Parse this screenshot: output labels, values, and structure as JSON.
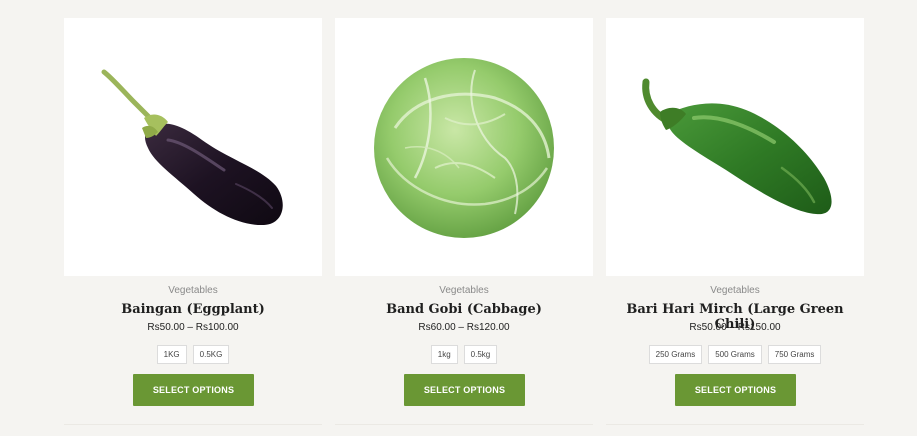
{
  "products": [
    {
      "category": "Vegetables",
      "title": "Baingan (Eggplant)",
      "price": "Rs50.00 – Rs100.00",
      "variations": [
        "1KG",
        "0.5KG"
      ],
      "button_label": "SELECT OPTIONS",
      "image_icon": "eggplant-image"
    },
    {
      "category": "Vegetables",
      "title": "Band Gobi (Cabbage)",
      "price": "Rs60.00 – Rs120.00",
      "variations": [
        "1kg",
        "0.5kg"
      ],
      "button_label": "SELECT OPTIONS",
      "image_icon": "cabbage-image"
    },
    {
      "category": "Vegetables",
      "title": "Bari Hari Mirch (Large Green Chili)",
      "price": "Rs50.00 – Rs150.00",
      "variations": [
        "250 Grams",
        "500 Grams",
        "750 Grams"
      ],
      "button_label": "SELECT OPTIONS",
      "image_icon": "green-chili-image"
    }
  ],
  "colors": {
    "button": "#6a9734",
    "page_background": "#f5f4f1"
  }
}
